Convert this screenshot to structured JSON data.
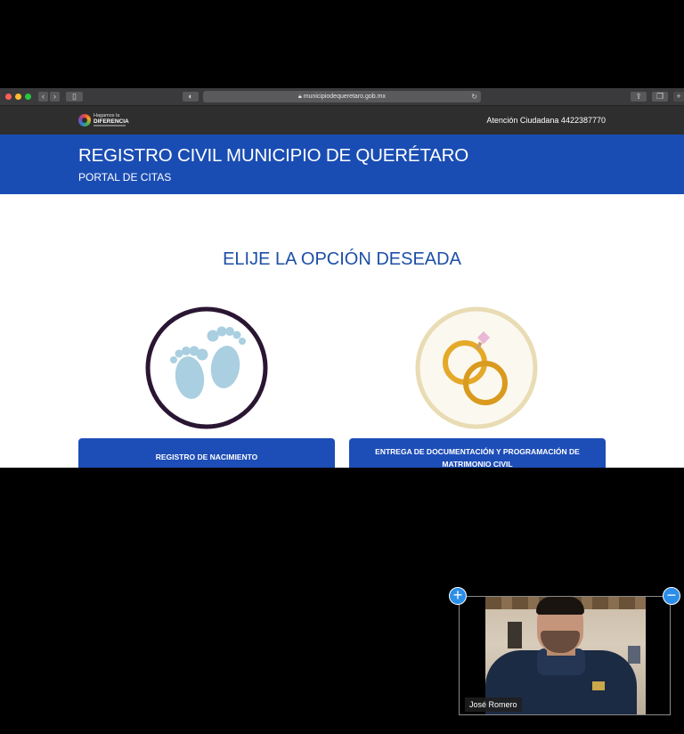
{
  "browser": {
    "url": "municipiodequeretaro.gob.mx"
  },
  "site": {
    "logo": {
      "line1": "Hagamos la",
      "line2": "DIFERENCIA"
    },
    "contact": "Atención Ciudadana 4422387770",
    "title": "REGISTRO CIVIL MUNICIPIO DE QUERÉTARO",
    "subtitle": "PORTAL DE CITAS"
  },
  "main": {
    "heading": "ELIJE LA OPCIÓN DESEADA",
    "options": [
      {
        "label": "REGISTRO DE NACIMIENTO",
        "icon": "baby-feet-icon"
      },
      {
        "label": "ENTREGA DE DOCUMENTACIÓN Y PROGRAMACIÓN DE MATRIMONIO CIVIL",
        "icon": "wedding-rings-icon"
      }
    ]
  },
  "video": {
    "participant_name": "José Romero",
    "plus_label": "+",
    "minus_label": "−"
  },
  "colors": {
    "brand_blue": "#1a4db3",
    "heading_blue": "#1e4fa6",
    "control_blue": "#2b8ee8"
  }
}
